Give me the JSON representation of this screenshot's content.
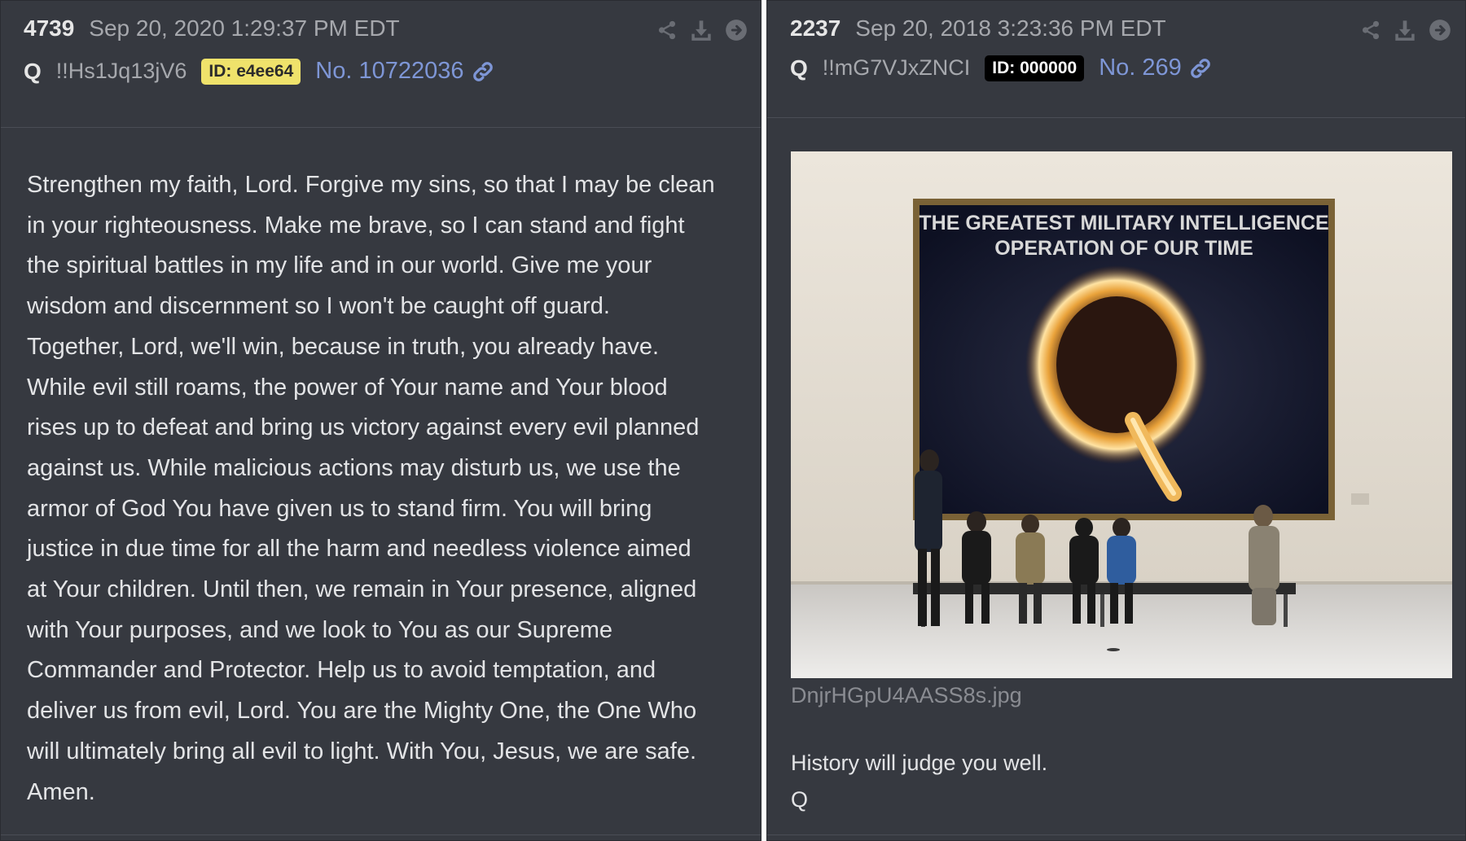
{
  "left_post": {
    "number": "4739",
    "date": "Sep 20, 2020 1:29:37 PM EDT",
    "author": "Q",
    "tripcode": "!!Hs1Jq13jV6",
    "id_badge": "ID: e4ee64",
    "id_badge_bg": "#efe26b",
    "id_badge_fg": "#2b2b2b",
    "post_link": "No. 10722036",
    "icons": [
      "share-icon",
      "download-icon",
      "arrow-right-circle-icon"
    ],
    "body_lines": [
      "Strengthen my faith, Lord. Forgive my sins, so that I may be clean",
      "in your righteousness. Make me brave, so I can stand and fight",
      "the spiritual battles in my life and in our world. Give me your",
      "wisdom and discernment so I won't be caught off guard.",
      "Together, Lord, we'll win, because in truth, you already have.",
      "While evil still roams, the power of Your name and Your blood",
      "rises up to defeat and bring us victory against every evil planned",
      "against us. While malicious actions may disturb us, we use the",
      "armor of God You have given us to stand firm. You will bring",
      "justice in due time for all the harm and needless violence aimed",
      "at Your children. Until then, we remain in Your presence, aligned",
      "with Your purposes, and we look to You as our Supreme",
      "Commander and Protector. Help us to avoid temptation, and",
      "deliver us from evil, Lord. You are the Mighty One, the One Who",
      "will ultimately bring all evil to light. With You, Jesus, we are safe.",
      "Amen."
    ]
  },
  "right_post": {
    "number": "2237",
    "date": "Sep 20, 2018 3:23:36 PM EDT",
    "author": "Q",
    "tripcode": "!!mG7VJxZNCI",
    "id_badge": "ID: 000000",
    "id_badge_bg": "#000000",
    "id_badge_fg": "#ffffff",
    "post_link": "No. 269",
    "icons": [
      "share-icon",
      "download-icon",
      "arrow-right-circle-icon"
    ],
    "image_caption_lines": [
      "THE GREATEST MILITARY INTELLIGENCE",
      "OPERATION OF OUR TIME"
    ],
    "image_letter": "Q",
    "filename": "DnjrHGpU4AASS8s.jpg",
    "reply_lines": [
      "History will judge you well.",
      "Q"
    ]
  },
  "colors": {
    "panel_bg": "#363940",
    "link": "#7e96d6",
    "text": "#e3e4e6",
    "muted": "#a6a8ad"
  }
}
